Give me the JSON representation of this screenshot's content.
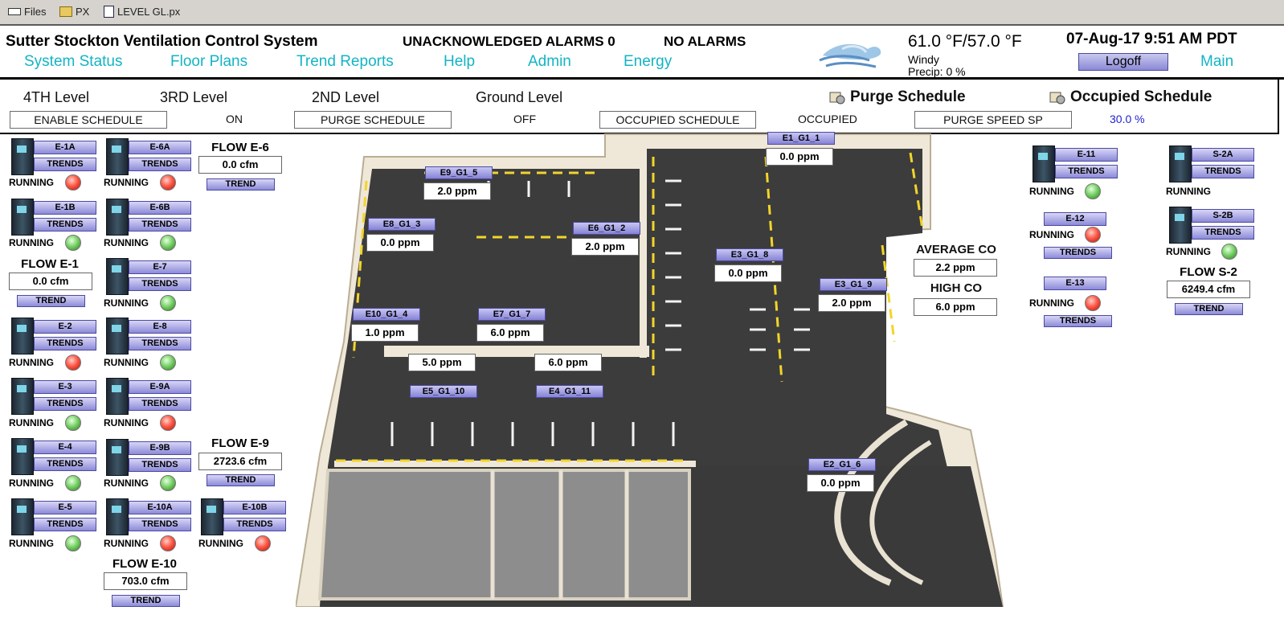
{
  "filebar": {
    "files": "Files",
    "px": "PX",
    "file": "LEVEL GL.px"
  },
  "header": {
    "title": "Sutter Stockton Ventilation Control System",
    "unack": "UNACKNOWLEDGED ALARMS 0",
    "alarms": "NO ALARMS",
    "nav": [
      "System Status",
      "Floor Plans",
      "Trend Reports",
      "Help",
      "Admin",
      "Energy"
    ],
    "temp": "61.0 °F/57.0 °F",
    "wind": "Windy",
    "precip": "Precip: 0 %",
    "datetime": "07-Aug-17 9:51 AM PDT",
    "logoff": "Logoff",
    "main": "Main"
  },
  "schedule": {
    "levels": [
      "4TH Level",
      "3RD Level",
      "2ND Level",
      "Ground Level"
    ],
    "enable_schedule": "ENABLE SCHEDULE",
    "enable_state": "ON",
    "purge_schedule": "PURGE SCHEDULE",
    "purge_state": "OFF",
    "occupied_schedule": "OCCUPIED SCHEDULE",
    "occupied_state": "OCCUPIED",
    "purge_speed": "PURGE SPEED SP",
    "purge_speed_val": "30.0 %",
    "purge_title": "Purge Schedule",
    "occupied_title": "Occupied Schedule"
  },
  "common": {
    "trends": "TRENDS",
    "trend": "TREND",
    "running": "RUNNING"
  },
  "fans": {
    "e1a": {
      "name": "E-1A",
      "state": "red"
    },
    "e6a": {
      "name": "E-6A",
      "state": "red"
    },
    "e1b": {
      "name": "E-1B",
      "state": "green"
    },
    "e6b": {
      "name": "E-6B",
      "state": "green"
    },
    "e7": {
      "name": "E-7",
      "state": "green"
    },
    "e2": {
      "name": "E-2",
      "state": "red"
    },
    "e8": {
      "name": "E-8",
      "state": "green"
    },
    "e3": {
      "name": "E-3",
      "state": "green"
    },
    "e9a": {
      "name": "E-9A",
      "state": "red"
    },
    "e4": {
      "name": "E-4",
      "state": "green"
    },
    "e9b": {
      "name": "E-9B",
      "state": "green"
    },
    "e5": {
      "name": "E-5",
      "state": "green"
    },
    "e10a": {
      "name": "E-10A",
      "state": "red"
    },
    "e10b": {
      "name": "E-10B",
      "state": "red"
    },
    "e11": {
      "name": "E-11",
      "state": "green"
    },
    "e12": {
      "name": "E-12",
      "state": "red"
    },
    "e13": {
      "name": "E-13",
      "state": "red"
    },
    "s2a": {
      "name": "S-2A",
      "state": "none"
    },
    "s2b": {
      "name": "S-2B",
      "state": "green"
    }
  },
  "flows": {
    "e1": {
      "title": "FLOW E-1",
      "value": "0.0 cfm"
    },
    "e6": {
      "title": "FLOW E-6",
      "value": "0.0 cfm"
    },
    "e9": {
      "title": "FLOW E-9",
      "value": "2723.6 cfm"
    },
    "e10": {
      "title": "FLOW E-10",
      "value": "703.0 cfm"
    },
    "s2": {
      "title": "FLOW S-2",
      "value": "6249.4 cfm"
    }
  },
  "sensors": {
    "e1": {
      "name": "E1_G1_1",
      "value": "0.0 ppm"
    },
    "e9": {
      "name": "E9_G1_5",
      "value": "2.0 ppm"
    },
    "e8": {
      "name": "E8_G1_3",
      "value": "0.0 ppm"
    },
    "e6": {
      "name": "E6_G1_2",
      "value": "2.0 ppm"
    },
    "e3a": {
      "name": "E3_G1_8",
      "value": "0.0 ppm"
    },
    "e3b": {
      "name": "E3_G1_9",
      "value": "2.0 ppm"
    },
    "e10": {
      "name": "E10_G1_4",
      "value": "1.0 ppm"
    },
    "e7": {
      "name": "E7_G1_7",
      "value": "6.0 ppm"
    },
    "e5": {
      "name": "E5_G1_10",
      "value": "5.0 ppm"
    },
    "e4": {
      "name": "E4_G1_11",
      "value": "6.0 ppm"
    },
    "e2": {
      "name": "E2_G1_6",
      "value": "0.0 ppm"
    }
  },
  "co": {
    "avg_label": "AVERAGE CO",
    "avg": "2.2 ppm",
    "high_label": "HIGH CO",
    "high": "6.0 ppm"
  },
  "icons": {
    "files": "folder-icon",
    "weather": "wind-cloud-icon",
    "schedule": "calendar-gear-icon"
  }
}
